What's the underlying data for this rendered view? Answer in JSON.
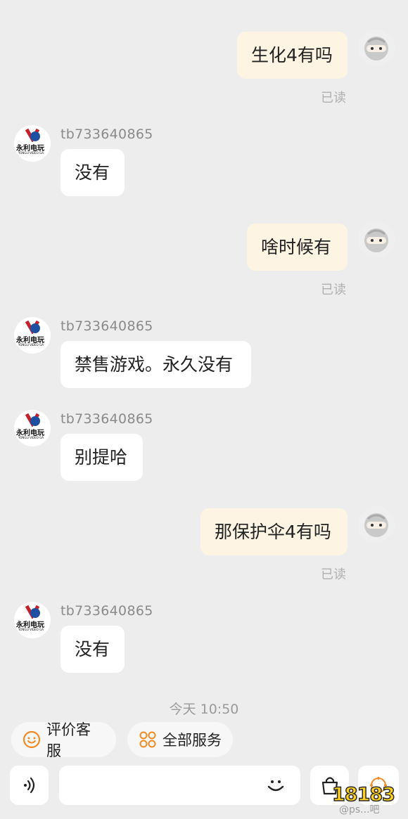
{
  "messages": [
    {
      "side": "out",
      "text": "生化4有吗",
      "status": "已读"
    },
    {
      "side": "in",
      "sender": "tb733640865",
      "text": "没有"
    },
    {
      "side": "out",
      "text": "啥时候有",
      "status": "已读"
    },
    {
      "side": "in",
      "sender": "tb733640865",
      "text": "禁售游戏。永久没有"
    },
    {
      "side": "in",
      "sender": "tb733640865",
      "text": "别提哈"
    },
    {
      "side": "out",
      "text": "那保护伞4有吗",
      "status": "已读"
    },
    {
      "side": "in",
      "sender": "tb733640865",
      "text": "没有"
    }
  ],
  "shop_avatar": {
    "brand_text": "永利电玩",
    "sub_text": "YONGLI VIDEO GA"
  },
  "timestamp": "今天 10:50",
  "quick_actions": [
    {
      "label": "评价客服",
      "icon": "smile-icon"
    },
    {
      "label": "全部服务",
      "icon": "grid-icon"
    }
  ],
  "input_bar": {
    "voice_icon": "voice-icon",
    "emoji_icon": "emoji-icon",
    "bag_icon": "shopping-bag-icon",
    "placeholder": ""
  },
  "watermark": {
    "text": "18183",
    "sub": "@ps...吧"
  },
  "colors": {
    "outgoing_bubble": "#fdf4e3",
    "incoming_bubble": "#ffffff",
    "accent_orange": "#f08a24"
  }
}
